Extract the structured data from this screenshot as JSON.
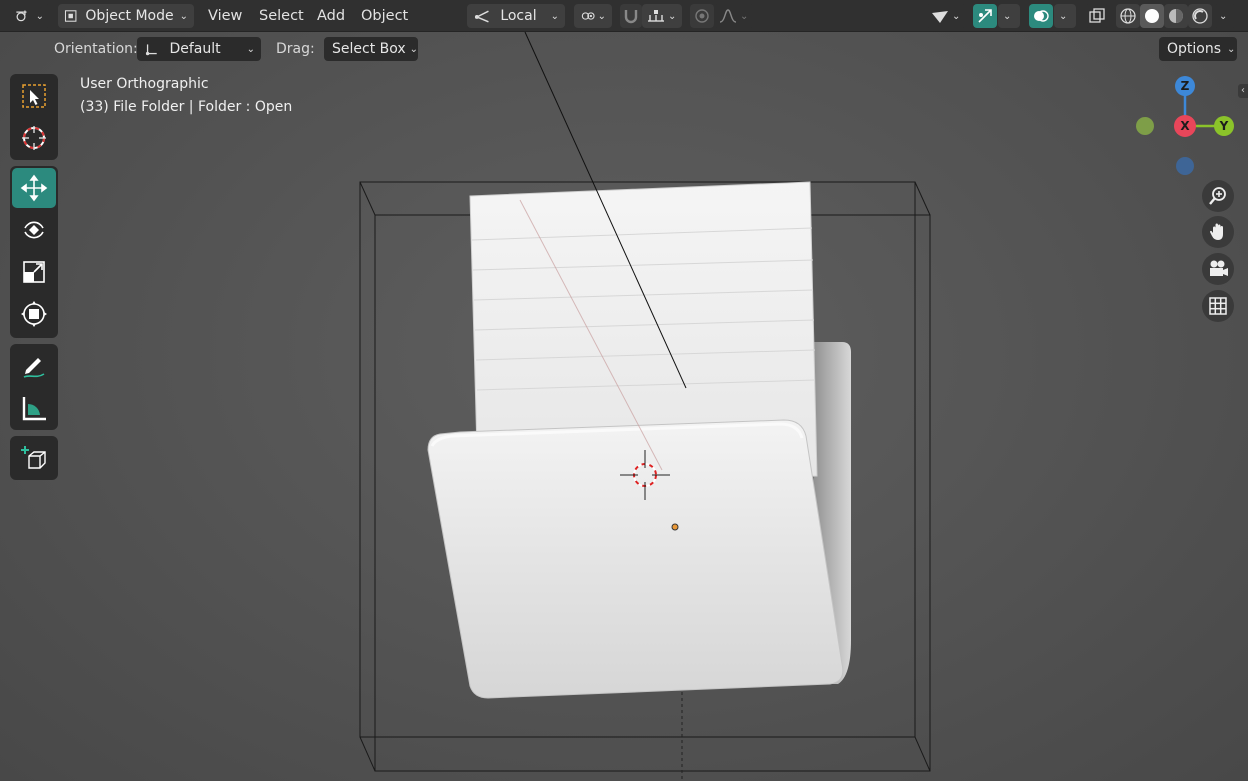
{
  "header": {
    "editor_type_icon": "editor-type-icon",
    "mode": "Object Mode",
    "menu": [
      "View",
      "Select",
      "Add",
      "Object"
    ],
    "transform_orientation": "Local"
  },
  "toolsettings": {
    "orientation_label": "Orientation:",
    "orientation_value": "Default",
    "drag_label": "Drag:",
    "drag_value": "Select Box",
    "options_label": "Options"
  },
  "viewport": {
    "view_name": "User Orthographic",
    "object_info": "(33) File Folder | Folder : Open"
  },
  "gizmo": {
    "z_label": "Z",
    "x_label": "X",
    "y_label": "Y",
    "colors": {
      "x": "#e8465a",
      "y": "#8bc32a",
      "z": "#3d88d8"
    }
  },
  "toolbar": {
    "tools": [
      "select-box",
      "cursor",
      "move",
      "rotate",
      "scale",
      "transform",
      "annotate",
      "measure",
      "add-cube"
    ],
    "active": "move"
  },
  "colors": {
    "accent": "#2c8a7e",
    "header_bg": "#303030",
    "viewport_bg": "#555555"
  }
}
